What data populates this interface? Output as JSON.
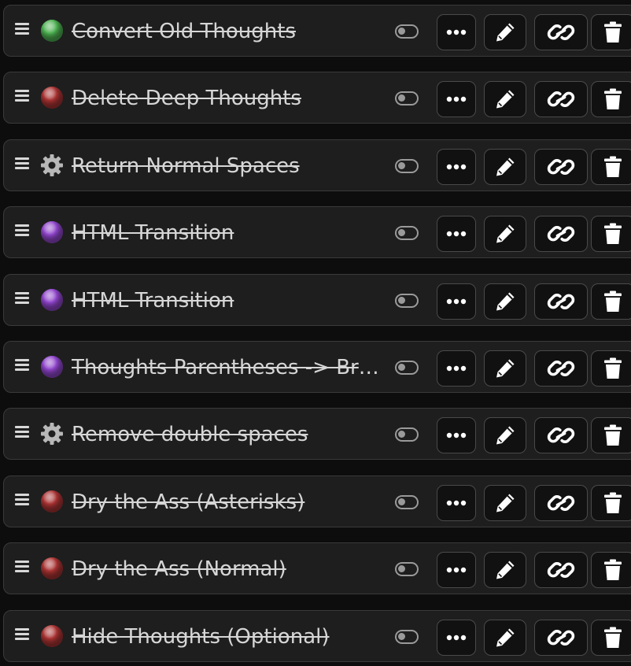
{
  "regex_scripts": [
    {
      "name": "Convert Old Thoughts",
      "icon": "green-circle-icon",
      "disabled": true
    },
    {
      "name": "Delete Deep Thoughts",
      "icon": "red-circle-icon",
      "disabled": true
    },
    {
      "name": "Return Normal Spaces",
      "icon": "gear-icon",
      "disabled": true
    },
    {
      "name": "HTML Transition",
      "icon": "purple-circle-icon",
      "disabled": true
    },
    {
      "name": "HTML Transition",
      "icon": "purple-circle-icon",
      "disabled": true
    },
    {
      "name": "Thoughts Parentheses -> Brackets",
      "icon": "purple-circle-icon",
      "disabled": true
    },
    {
      "name": "Remove double spaces",
      "icon": "gear-icon",
      "disabled": true
    },
    {
      "name": "Dry the Ass (Asterisks)",
      "icon": "red-circle-icon",
      "disabled": true
    },
    {
      "name": "Dry the Ass (Normal)",
      "icon": "red-circle-icon",
      "disabled": true
    },
    {
      "name": "Hide Thoughts (Optional)",
      "icon": "red-circle-icon",
      "disabled": true
    }
  ],
  "actions": {
    "drag_icon": "drag-handle-icon",
    "toggle_icon": "toggle-off-icon",
    "more_icon": "ellipsis-icon",
    "edit_icon": "pencil-icon",
    "link_icon": "link-icon",
    "delete_icon": "trash-icon"
  },
  "colors": {
    "green": "#4caf50",
    "red": "#a83232",
    "purple": "#8e44c9",
    "gear": "#b8b8b8",
    "row_background": "#1e1e1e",
    "row_border": "#3a3a3a",
    "text": "#d6d6d6"
  }
}
